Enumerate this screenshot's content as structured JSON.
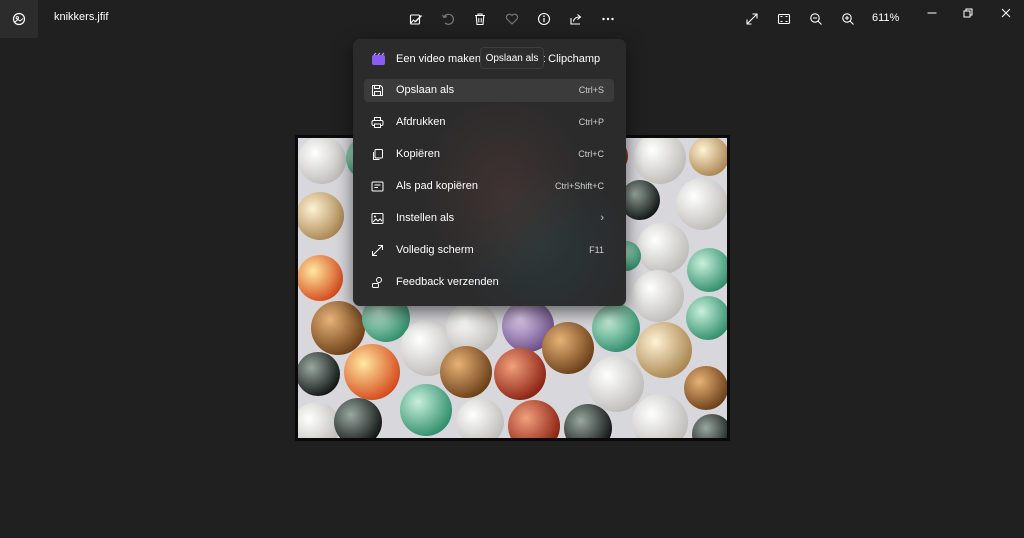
{
  "window": {
    "file_name": "knikkers.jfif",
    "zoom_level": "611%"
  },
  "toolbar": {
    "icons": [
      "edit-image-icon",
      "rotate-icon",
      "delete-icon",
      "favorite-icon",
      "info-icon",
      "share-icon",
      "more-options-icon"
    ],
    "right_icons": [
      "full-screen-icon",
      "fit-to-window-icon",
      "zoom-out-icon",
      "zoom-in-icon"
    ]
  },
  "tooltip": {
    "text": "Opslaan als"
  },
  "menu": {
    "clipchamp_left": "Een video maken",
    "clipchamp_right": "ft Clipchamp",
    "items": [
      {
        "label": "Opslaan als",
        "shortcut": "Ctrl+S",
        "icon": "save-icon"
      },
      {
        "label": "Afdrukken",
        "shortcut": "Ctrl+P",
        "icon": "print-icon"
      },
      {
        "label": "Kopiëren",
        "shortcut": "Ctrl+C",
        "icon": "copy-icon"
      },
      {
        "label": "Als pad kopiëren",
        "shortcut": "Ctrl+Shift+C",
        "icon": "copy-path-icon"
      },
      {
        "label": "Instellen als",
        "shortcut": "",
        "icon": "set-as-icon"
      },
      {
        "label": "Volledig scherm",
        "shortcut": "F11",
        "icon": "fullscreen-icon"
      },
      {
        "label": "Feedback verzenden",
        "shortcut": "",
        "icon": "feedback-icon"
      }
    ]
  },
  "colors": {
    "background": "#202020",
    "menu_background": "#2b2b2c",
    "highlight": "#3b3b3c",
    "clipchamp_accent": "#8a5cf5"
  }
}
